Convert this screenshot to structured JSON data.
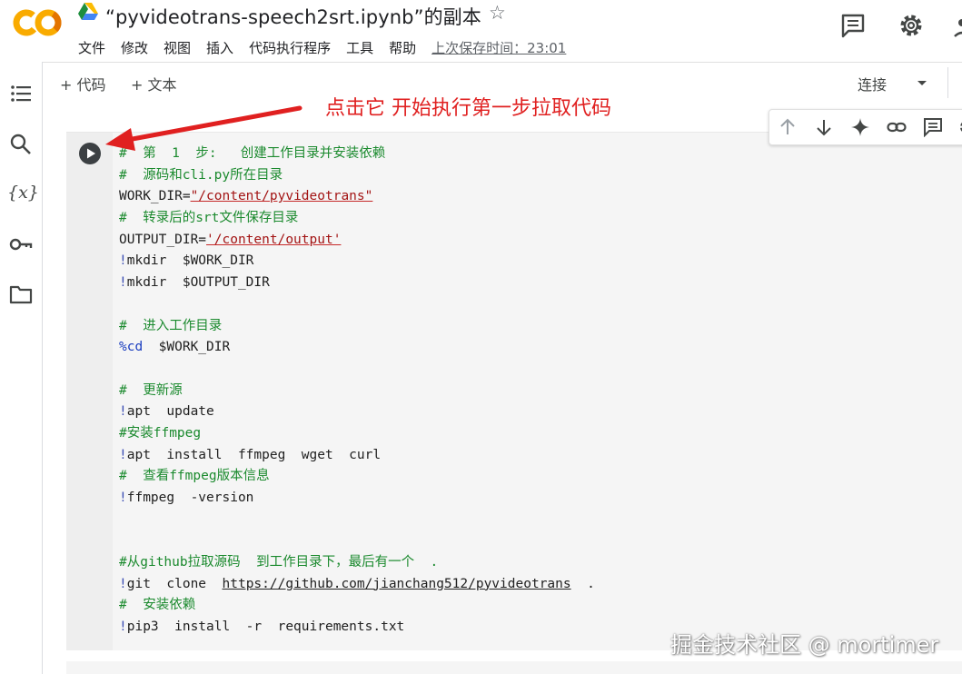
{
  "header": {
    "logo_text": "CO",
    "doc_title": "“pyvideotrans-speech2srt.ipynb”的副本",
    "menu": [
      "文件",
      "修改",
      "视图",
      "插入",
      "代码执行程序",
      "工具",
      "帮助"
    ],
    "last_saved": "上次保存时间：23:01"
  },
  "toolbar": {
    "add_code": "+ 代码",
    "add_text": "+ 文本",
    "connect": "连接"
  },
  "annotation": "点击它 开始执行第一步拉取代码",
  "watermark": "掘金技术社区 @ mortimer",
  "code": {
    "l1": "#  第  1  步:   创建工作目录并安装依赖",
    "l2": "#  源码和cli.py所在目录",
    "l3a": "WORK_DIR=",
    "l3b": "\"/content/pyvideotrans\"",
    "l4": "#  转录后的srt文件保存目录",
    "l5a": "OUTPUT_DIR=",
    "l5b": "'/content/output'",
    "l6a": "!",
    "l6b": "mkdir  $WORK_DIR",
    "l7a": "!",
    "l7b": "mkdir  $OUTPUT_DIR",
    "l9": "#  进入工作目录",
    "l10a": "%cd",
    "l10b": "  $WORK_DIR",
    "l12": "#  更新源",
    "l13a": "!",
    "l13b": "apt  update",
    "l14": "#安装ffmpeg",
    "l15a": "!",
    "l15b": "apt  install  ffmpeg  wget  curl",
    "l16": "#  查看ffmpeg版本信息",
    "l17a": "!",
    "l17b": "ffmpeg  -version",
    "l20": "#从github拉取源码  到工作目录下，最后有一个  .",
    "l21a": "!",
    "l21b": "git  clone  ",
    "l21c": "https://github.com/jianchang512/pyvideotrans",
    "l21d": "  .",
    "l22": "#  安装依赖",
    "l23a": "!",
    "l23b": "pip3  install  -r  requirements.txt"
  },
  "icons": {
    "logo": "colab-logo-icon",
    "drive": "google-drive-icon",
    "star": "star-icon",
    "comment": "comment-icon",
    "settings": "gear-icon",
    "rail": [
      "table-of-contents-icon",
      "search-icon",
      "variables-icon",
      "key-icon",
      "folder-icon"
    ],
    "cell_toolbar": [
      "arrow-up-icon",
      "arrow-down-icon",
      "sparkle-icon",
      "link-icon",
      "comment-icon"
    ],
    "run": "play-icon"
  },
  "colors": {
    "logo_orange": "#F9AB00",
    "logo_dark_orange": "#E37400",
    "comment_green": "#1b8a2e",
    "string_red": "#a31515",
    "annotation_red": "#e02020"
  }
}
